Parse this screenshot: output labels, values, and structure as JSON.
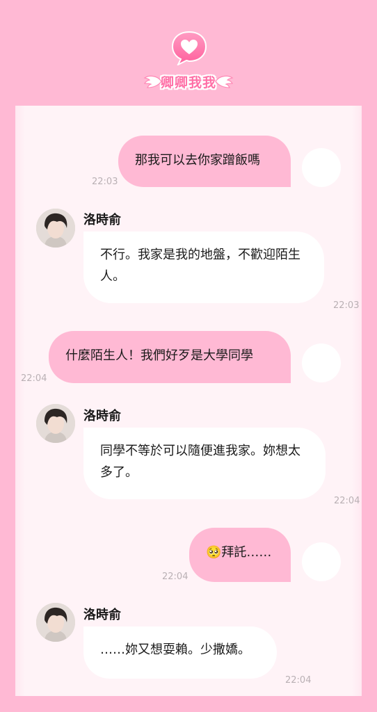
{
  "app": {
    "logo_text": "卿卿我我"
  },
  "colors": {
    "background": "#ffb9d4",
    "my_bubble": "#ffb9d4",
    "their_bubble": "#ffffff",
    "logo_pink": "#ff6fa6"
  },
  "messages": [
    {
      "side": "me",
      "text": "那我可以去你家蹭飯嗎",
      "time": "22:03"
    },
    {
      "side": "them",
      "sender": "洛時俞",
      "text": "不行。我家是我的地盤，不歡迎陌生人。",
      "time": "22:03"
    },
    {
      "side": "me",
      "text": "什麼陌生人！我們好歹是大學同學",
      "time": "22:04"
    },
    {
      "side": "them",
      "sender": "洛時俞",
      "text": "同學不等於可以隨便進我家。妳想太多了。",
      "time": "22:04"
    },
    {
      "side": "me",
      "text": "🥺拜託……",
      "time": "22:04"
    },
    {
      "side": "them",
      "sender": "洛時俞",
      "text": "……妳又想耍賴。少撒嬌。",
      "time": "22:04"
    }
  ]
}
